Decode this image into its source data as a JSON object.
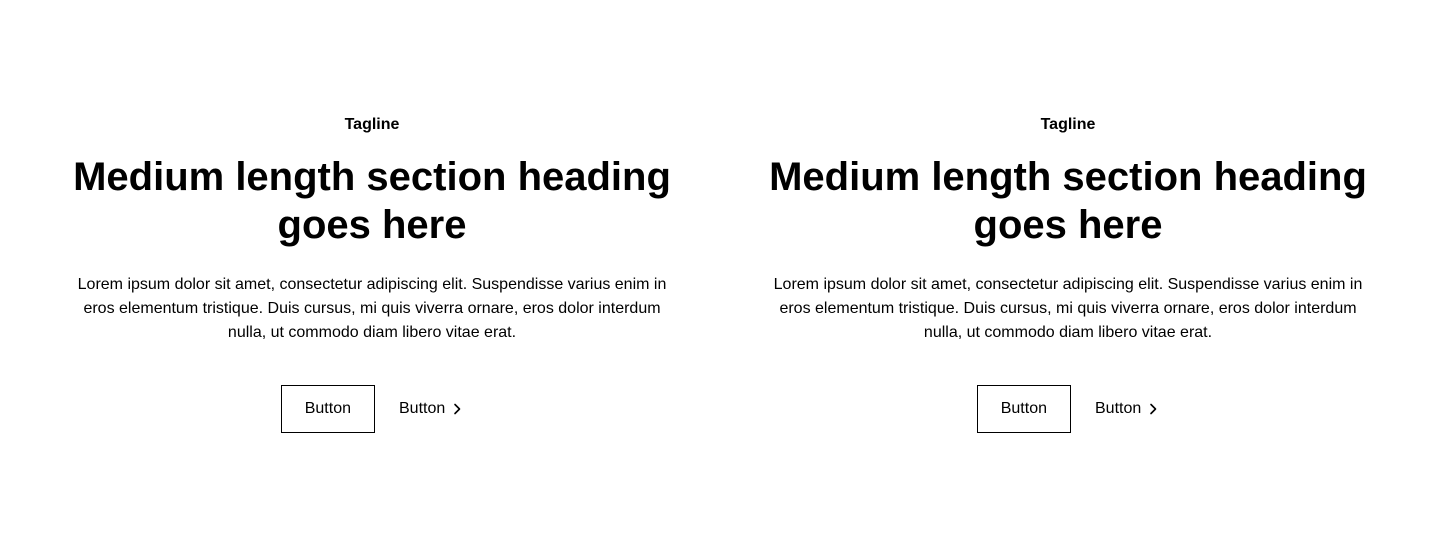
{
  "sections": [
    {
      "tagline": "Tagline",
      "heading": "Medium length section heading goes here",
      "body": "Lorem ipsum dolor sit amet, consectetur adipiscing elit. Suspendisse varius enim in eros elementum tristique. Duis cursus, mi quis viverra ornare, eros dolor interdum nulla, ut commodo diam libero vitae erat.",
      "primary_button": "Button",
      "link_button": "Button",
      "link_icon": "chevron-right-icon"
    },
    {
      "tagline": "Tagline",
      "heading": "Medium length section heading goes here",
      "body": "Lorem ipsum dolor sit amet, consectetur adipiscing elit. Suspendisse varius enim in eros elementum tristique. Duis cursus, mi quis viverra ornare, eros dolor interdum nulla, ut commodo diam libero vitae erat.",
      "primary_button": "Button",
      "link_button": "Button",
      "link_icon": "chevron-right-icon"
    }
  ],
  "colors": {
    "background": "#ffffff",
    "text": "#000000",
    "border": "#000000"
  }
}
